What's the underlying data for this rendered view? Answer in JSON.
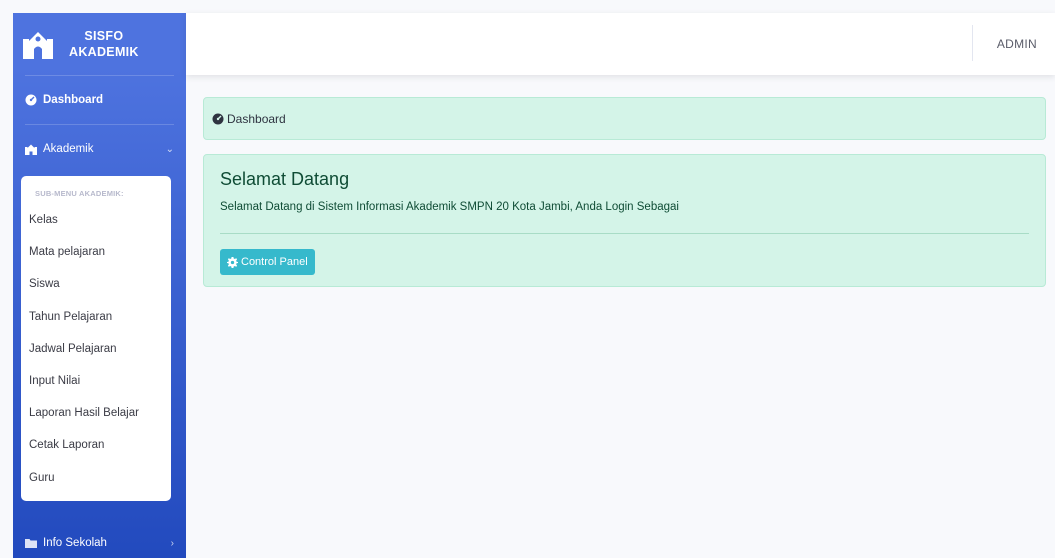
{
  "brand": {
    "line1": "SISFO",
    "line2": "AKADEMIK",
    "icon": "school-icon"
  },
  "sidebar": {
    "dashboard": {
      "label": "Dashboard",
      "icon": "tachometer-icon"
    },
    "akademik": {
      "label": "Akademik",
      "icon": "school-icon"
    },
    "submenu_header": "SUB-MENU AKADEMIK:",
    "submenu": [
      "Kelas",
      "Mata pelajaran",
      "Siswa",
      "Tahun Pelajaran",
      "Jadwal Pelajaran",
      "Input Nilai",
      "Laporan Hasil Belajar",
      "Cetak Laporan",
      "Guru"
    ],
    "info": {
      "label": "Info Sekolah",
      "icon": "folder-icon"
    }
  },
  "topbar": {
    "user": "ADMIN"
  },
  "breadcrumb": {
    "label": "Dashboard",
    "icon": "tachometer-icon"
  },
  "welcome": {
    "title": "Selamat Datang",
    "text": "Selamat Datang di Sistem Informasi Akademik SMPN 20 Kota Jambi, Anda Login Sebagai",
    "button": "Control Panel",
    "button_icon": "gear-icon"
  },
  "colors": {
    "sidebar_top": "#4e73df",
    "sidebar_bottom": "#224abe",
    "card_bg": "#d4f4e8",
    "button": "#36b9cc"
  }
}
